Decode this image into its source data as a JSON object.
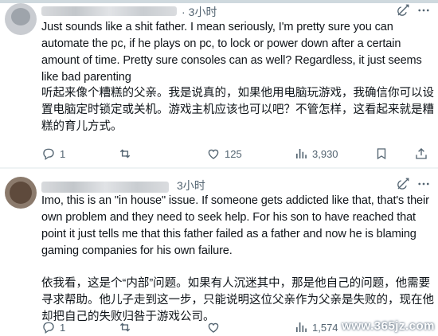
{
  "tweets": [
    {
      "time": "3小时",
      "text_en": "Just sounds like a shit father. I mean seriously, I'm pretty sure you can automate the pc, if he plays on pc, to lock or power down after a certain amount of time. Pretty sure consoles can as well? Regardless, it just seems like bad parenting",
      "text_zh": "听起来像个糟糕的父亲。我是说真的，如果他用电脑玩游戏，我确信你可以设置电脑定时锁定或关机。游戏主机应该也可以吧？不管怎样，这看起来就是糟糕的育儿方式。",
      "replies": "1",
      "reposts": "",
      "likes": "125",
      "views": "3,930"
    },
    {
      "time": "3小时",
      "text_en": "Imo, this is an \"in house\" issue. If someone gets addicted like that, that's their own problem and they need to seek help. For his son to have reached that point it just tells me that this father failed as a father and now he is blaming gaming companies for his own failure.",
      "text_zh": "依我看，这是个“内部”问题。如果有人沉迷其中，那是他自己的问题，他需要寻求帮助。他儿子走到这一步，只能说明这位父亲作为父亲是失败的，现在他却把自己的失败归咎于游戏公司。",
      "replies": "1",
      "reposts": "",
      "likes": "",
      "views": "1,574"
    }
  ],
  "watermark": "www.365jz.com",
  "icons": [
    "reply-icon",
    "repost-icon",
    "like-icon",
    "views-icon",
    "bookmark-icon",
    "share-icon",
    "grok-icon",
    "more-icon"
  ],
  "colors": {
    "text": "#0f1419",
    "secondary": "#536471",
    "divider": "#eff3f4"
  }
}
